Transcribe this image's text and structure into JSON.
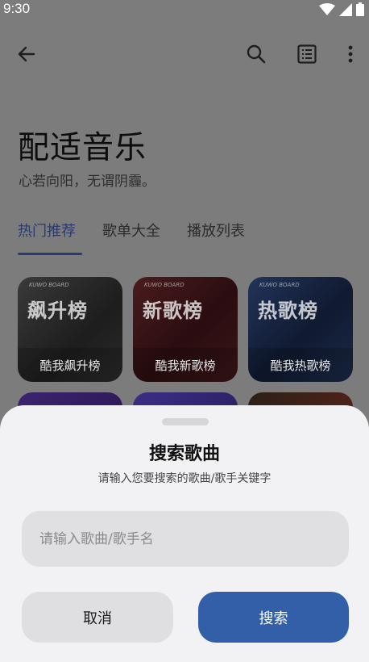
{
  "status_bar": {
    "time": "9:30"
  },
  "app_bar": {
    "back_icon": "arrow-left-icon",
    "search_icon": "search-icon",
    "list_icon": "list-icon",
    "more_icon": "more-vert-icon"
  },
  "header": {
    "title": "配适音乐",
    "subtitle": "心若向阳，无谓阴霾。"
  },
  "tabs": [
    {
      "label": "热门推荐",
      "active": true
    },
    {
      "label": "歌单大全",
      "active": false
    },
    {
      "label": "播放列表",
      "active": false
    }
  ],
  "cards": [
    {
      "big": "飙升榜",
      "caption": "酷我飙升榜",
      "brand": "KUWO BOARD"
    },
    {
      "big": "新歌榜",
      "caption": "酷我新歌榜",
      "brand": "KUWO BOARD"
    },
    {
      "big": "热歌榜",
      "caption": "酷我热歌榜",
      "brand": "KUWO BOARD"
    }
  ],
  "sheet": {
    "title": "搜索歌曲",
    "subtitle": "请输入您要搜索的歌曲/歌手关键字",
    "input_placeholder": "请输入歌曲/歌手名",
    "input_value": "",
    "cancel_label": "取消",
    "search_label": "搜索"
  },
  "colors": {
    "accent": "#335fa8",
    "tab_active": "#2b3a6e",
    "scrim": "#7c7c7c"
  }
}
